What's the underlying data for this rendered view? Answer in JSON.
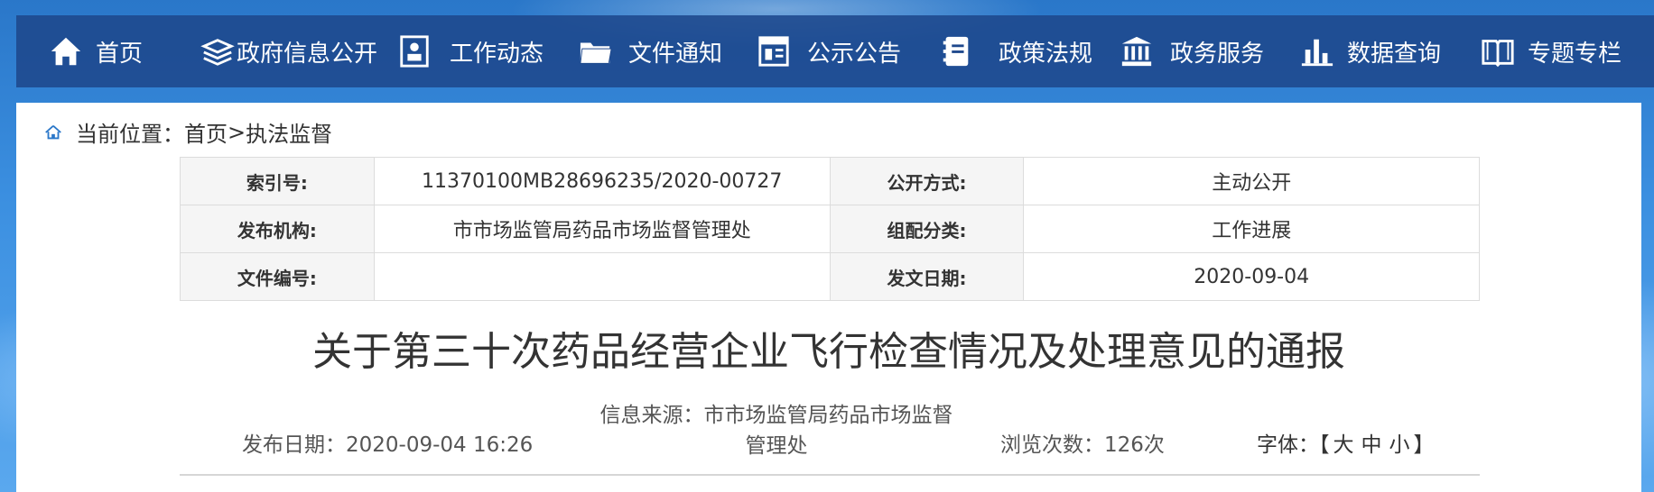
{
  "nav": {
    "items": [
      {
        "label": "首页",
        "icon": "home-icon"
      },
      {
        "label": "政府信息公开",
        "icon": "stack-icon"
      },
      {
        "label": "工作动态",
        "icon": "badge-icon"
      },
      {
        "label": "文件通知",
        "icon": "folder-icon"
      },
      {
        "label": "公示公告",
        "icon": "board-icon"
      },
      {
        "label": "政策法规",
        "icon": "book-icon"
      },
      {
        "label": "政务服务",
        "icon": "institution-icon"
      },
      {
        "label": "数据查询",
        "icon": "bar-chart-icon"
      },
      {
        "label": "专题专栏",
        "icon": "open-book-icon"
      }
    ]
  },
  "breadcrumb": {
    "prefix": "当前位置：",
    "home": "首页",
    "sep": ">",
    "current": "执法监督"
  },
  "meta": {
    "index_label": "索引号:",
    "index_value": "11370100MB28696235/2020-00727",
    "open_label": "公开方式:",
    "open_value": "主动公开",
    "org_label": "发布机构:",
    "org_value": "市市场监管局药品市场监督管理处",
    "cat_label": "组配分类:",
    "cat_value": "工作进展",
    "docno_label": "文件编号:",
    "docno_value": "",
    "date_label": "发文日期:",
    "date_value": "2020-09-04"
  },
  "article": {
    "title": "关于第三十次药品经营企业飞行检查情况及处理意见的通报",
    "publish": "发布日期：2020-09-04 16:26",
    "source_line1": "信息来源：市市场监管局药品市场监督",
    "source_line2": "管理处",
    "views": "浏览次数：126次",
    "font_label": "字体：",
    "font_open": "【",
    "font_large": "大",
    "font_medium": "中",
    "font_small": "小",
    "font_close": "】"
  }
}
